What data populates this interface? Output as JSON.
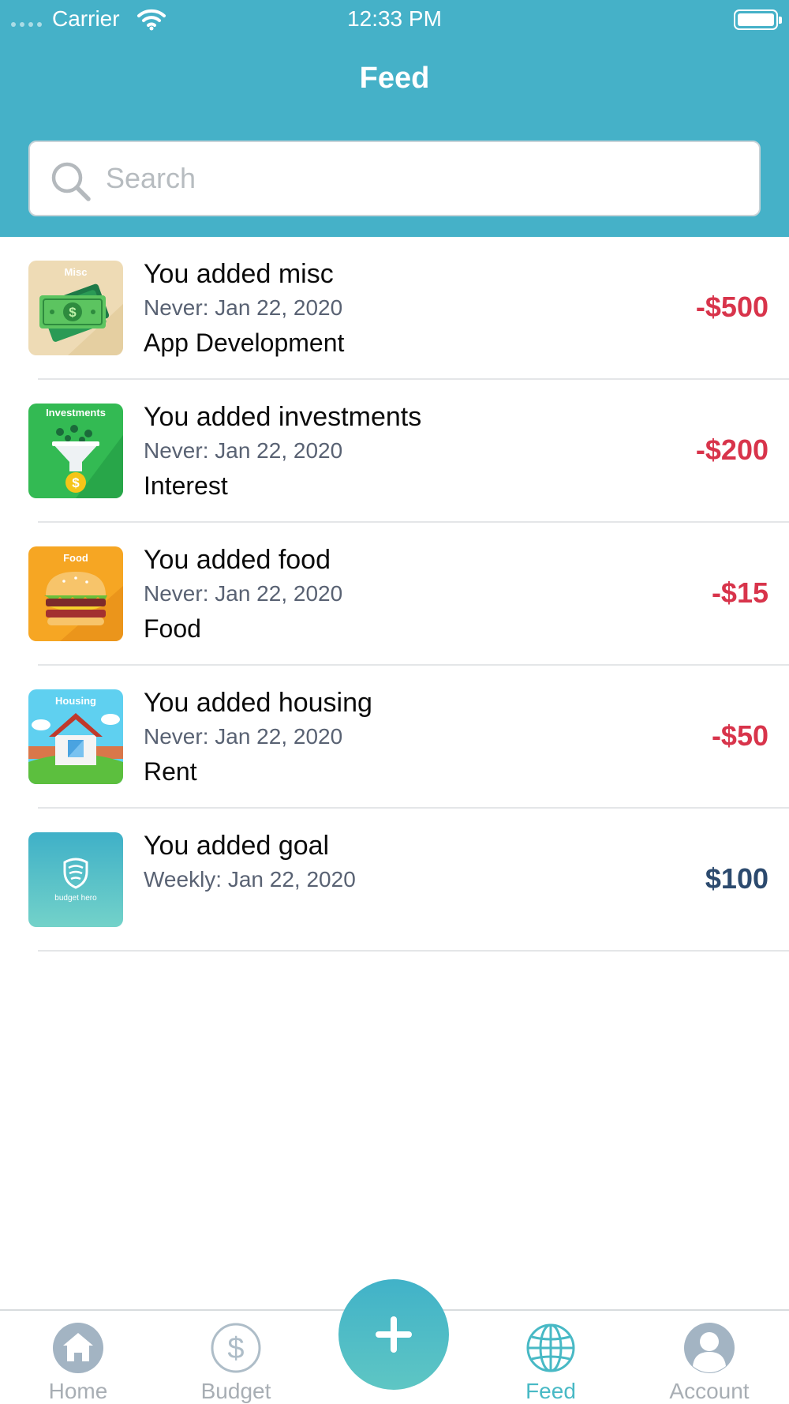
{
  "status_bar": {
    "carrier": "Carrier",
    "time": "12:33 PM"
  },
  "header": {
    "title": "Feed"
  },
  "search": {
    "placeholder": "Search",
    "value": ""
  },
  "feed": [
    {
      "thumb_label": "Misc",
      "title": "You added misc",
      "date": "Never: Jan 22, 2020",
      "note": "App Development",
      "amount": "-$500"
    },
    {
      "thumb_label": "Investments",
      "title": "You added investments",
      "date": "Never: Jan 22, 2020",
      "note": "Interest",
      "amount": "-$200"
    },
    {
      "thumb_label": "Food",
      "title": "You added food",
      "date": "Never: Jan 22, 2020",
      "note": "Food",
      "amount": "-$15"
    },
    {
      "thumb_label": "Housing",
      "title": "You added housing",
      "date": "Never: Jan 22, 2020",
      "note": "Rent",
      "amount": "-$50"
    },
    {
      "thumb_label": "budget hero",
      "title": "You added goal",
      "date": "Weekly: Jan 22, 2020",
      "note": "",
      "amount": "$100"
    }
  ],
  "tabbar": {
    "home": "Home",
    "budget": "Budget",
    "feed": "Feed",
    "account": "Account"
  },
  "colors": {
    "header": "#45b1c8",
    "negative": "#d8344b",
    "positive": "#2c4a6e",
    "active_tab": "#48b9c5"
  }
}
